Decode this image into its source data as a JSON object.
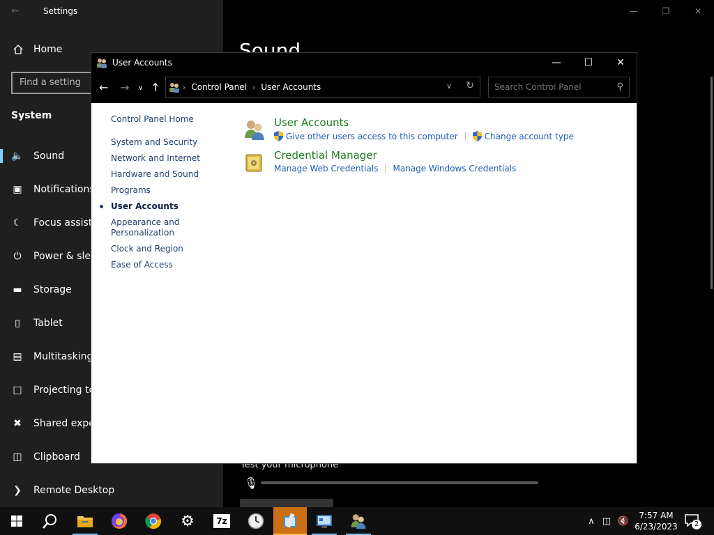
{
  "settings": {
    "title": "Settings",
    "home_label": "Home",
    "search_placeholder": "Find a setting",
    "section_label": "System",
    "nav_items": [
      {
        "label": "Sound",
        "icon": "speaker-icon",
        "selected": true
      },
      {
        "label": "Notifications & actions",
        "icon": "notification-icon"
      },
      {
        "label": "Focus assist",
        "icon": "moon-icon"
      },
      {
        "label": "Power & sleep",
        "icon": "power-icon"
      },
      {
        "label": "Storage",
        "icon": "storage-icon"
      },
      {
        "label": "Tablet",
        "icon": "tablet-icon"
      },
      {
        "label": "Multitasking",
        "icon": "multitasking-icon"
      },
      {
        "label": "Projecting to this PC",
        "icon": "projecting-icon"
      },
      {
        "label": "Shared experiences",
        "icon": "shared-icon"
      },
      {
        "label": "Clipboard",
        "icon": "clipboard-icon"
      },
      {
        "label": "Remote Desktop",
        "icon": "remote-desktop-icon"
      }
    ],
    "page_heading": "Sound",
    "mic_test_label": "Test your microphone"
  },
  "control_panel": {
    "window_title": "User Accounts",
    "breadcrumb": [
      "Control Panel",
      "User Accounts"
    ],
    "search_placeholder": "Search Control Panel",
    "left_nav": {
      "home": "Control Panel Home",
      "items": [
        {
          "label": "System and Security"
        },
        {
          "label": "Network and Internet"
        },
        {
          "label": "Hardware and Sound"
        },
        {
          "label": "Programs"
        },
        {
          "label": "User Accounts",
          "current": true
        },
        {
          "label": "Appearance and Personalization"
        },
        {
          "label": "Clock and Region"
        },
        {
          "label": "Ease of Access"
        }
      ]
    },
    "categories": [
      {
        "title": "User Accounts",
        "icon": "user-accounts-icon",
        "links": [
          {
            "label": "Give other users access to this computer",
            "shield": true
          },
          {
            "label": "Change account type",
            "shield": true
          }
        ]
      },
      {
        "title": "Credential Manager",
        "icon": "credential-manager-icon",
        "links": [
          {
            "label": "Manage Web Credentials",
            "shield": false
          },
          {
            "label": "Manage Windows Credentials",
            "shield": false
          }
        ]
      }
    ]
  },
  "taskbar": {
    "apps": [
      {
        "name": "start-button"
      },
      {
        "name": "search-button"
      },
      {
        "name": "file-explorer"
      },
      {
        "name": "firefox"
      },
      {
        "name": "chrome"
      },
      {
        "name": "settings"
      },
      {
        "name": "7zip",
        "label": "7z"
      },
      {
        "name": "clock-app"
      },
      {
        "name": "editor-app"
      },
      {
        "name": "control-panel-app"
      },
      {
        "name": "user-accounts-app"
      }
    ],
    "time": "7:57 AM",
    "date": "6/23/2023",
    "notification_count": "2"
  },
  "colors": {
    "accent": "#cc6f14",
    "link_blue": "#1a5fb4",
    "category_green": "#1d7a1d"
  }
}
